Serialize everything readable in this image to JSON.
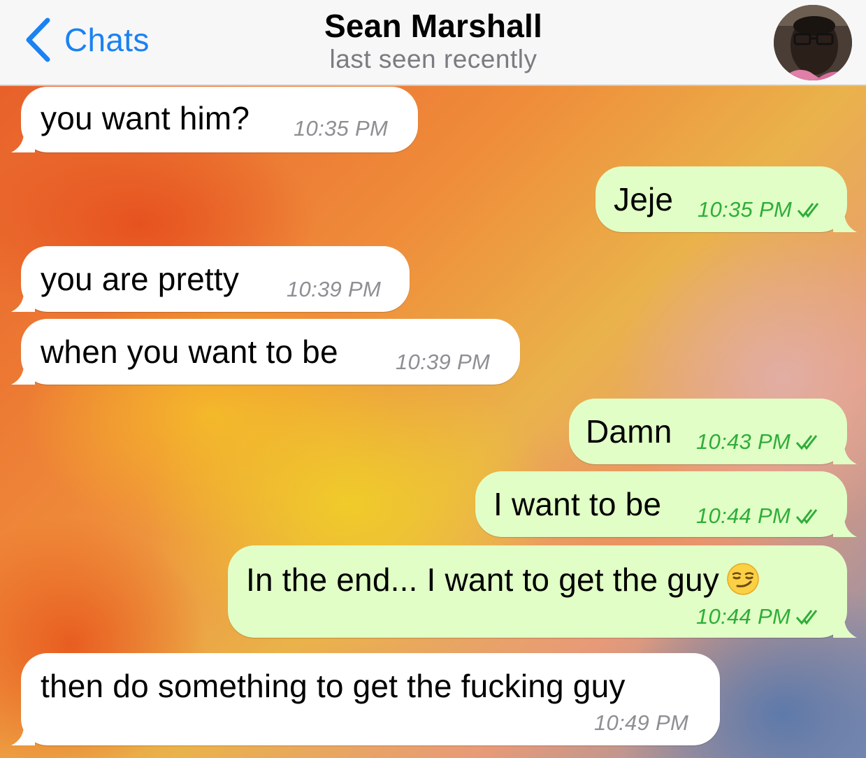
{
  "header": {
    "back_label": "Chats",
    "contact_name": "Sean Marshall",
    "status": "last seen recently",
    "back_icon": "chevron-left-icon",
    "accent_color": "#1a82f1"
  },
  "messages": [
    {
      "direction": "incoming",
      "text": "you want him?",
      "time": "10:35 PM"
    },
    {
      "direction": "outgoing",
      "text": "Jeje",
      "time": "10:35 PM",
      "read": true
    },
    {
      "direction": "incoming",
      "text": "you are pretty",
      "time": "10:39 PM"
    },
    {
      "direction": "incoming",
      "text": "when you want to be",
      "time": "10:39 PM"
    },
    {
      "direction": "outgoing",
      "text": "Damn",
      "time": "10:43 PM",
      "read": true
    },
    {
      "direction": "outgoing",
      "text": "I want to be",
      "time": "10:44 PM",
      "read": true
    },
    {
      "direction": "outgoing",
      "text": "In the end... I want to get the guy",
      "emoji": "smirking-face",
      "time": "10:44 PM",
      "read": true
    },
    {
      "direction": "incoming",
      "text": "then do something to get the fucking guy",
      "time": "10:49 PM"
    }
  ],
  "colors": {
    "incoming_bubble": "#ffffff",
    "outgoing_bubble": "#e1fec6",
    "outgoing_time": "#2fad3a",
    "incoming_time": "#8e8e93"
  }
}
